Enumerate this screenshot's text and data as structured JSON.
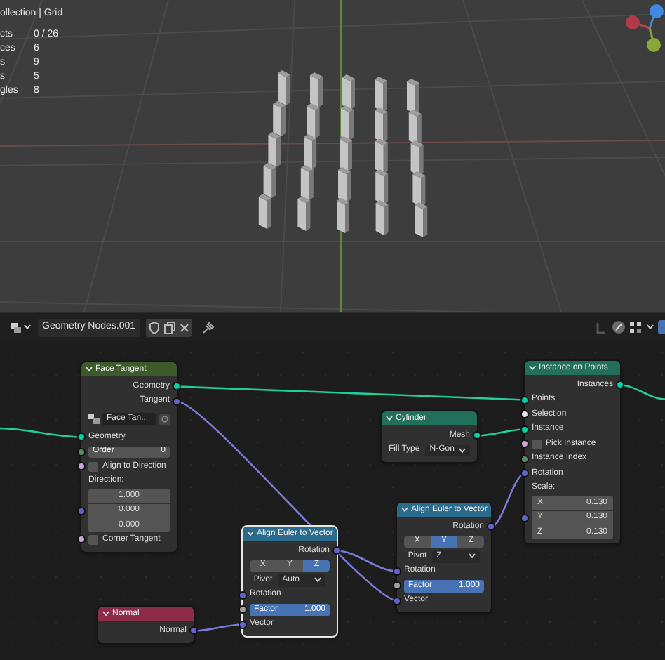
{
  "viewport": {
    "overlay_text": "ollection | Grid",
    "stats": [
      {
        "label": "cts",
        "value": "0 / 26"
      },
      {
        "label": "ces",
        "value": "6"
      },
      {
        "label": "s",
        "value": "9"
      },
      {
        "label": "s",
        "value": "5"
      },
      {
        "label": "gles",
        "value": "8"
      }
    ]
  },
  "node_editor": {
    "datablock": "Geometry Nodes.001"
  },
  "nodes": [
    {
      "title": "Face Tangent",
      "color": "#3d5a2a",
      "selected": false,
      "rows": [
        {
          "kind": "output",
          "label": "Geometry",
          "color": "#00d6a3"
        },
        {
          "kind": "output",
          "label": "Tangent",
          "color": "#6363c7"
        },
        {
          "kind": "datablock",
          "value": "Face Tan..."
        },
        {
          "kind": "input",
          "label": "Geometry",
          "color": "#00d6a3"
        },
        {
          "kind": "field",
          "label": "Order",
          "value": "0",
          "color": "#598c5c"
        },
        {
          "kind": "checkbox",
          "label": "Align to Direction",
          "checked": false,
          "color": "#cca6d6"
        },
        {
          "kind": "heading",
          "label": "Direction:"
        },
        {
          "kind": "vector",
          "color": "#6363c7",
          "values": [
            {
              "value": "1.000"
            },
            {
              "value": "0.000"
            },
            {
              "value": "0.000"
            }
          ]
        },
        {
          "kind": "checkbox",
          "label": "Corner Tangent",
          "checked": false,
          "color": "#cca6d6"
        }
      ]
    },
    {
      "title": "Instance on Points",
      "color": "#22705c",
      "selected": false,
      "rows": [
        {
          "kind": "output",
          "label": "Instances",
          "color": "#00d6a3"
        },
        {
          "kind": "input",
          "label": "Points",
          "color": "#00d6a3"
        },
        {
          "kind": "input",
          "label": "Selection",
          "color": "#e6e6e6"
        },
        {
          "kind": "input",
          "label": "Instance",
          "color": "#00d6a3"
        },
        {
          "kind": "checkbox",
          "label": "Pick Instance",
          "checked": false,
          "color": "#cca6d6"
        },
        {
          "kind": "input",
          "label": "Instance Index",
          "color": "#598c5c"
        },
        {
          "kind": "input",
          "label": "Rotation",
          "color": "#6363c7"
        },
        {
          "kind": "heading",
          "label": "Scale:"
        },
        {
          "kind": "vector",
          "color": "#6363c7",
          "values": [
            {
              "label": "X",
              "value": "0.130"
            },
            {
              "label": "Y",
              "value": "0.130"
            },
            {
              "label": "Z",
              "value": "0.130"
            }
          ]
        }
      ]
    },
    {
      "title": "Cylinder",
      "color": "#22705c",
      "selected": false,
      "rows": [
        {
          "kind": "output",
          "label": "Mesh",
          "color": "#00d6a3"
        },
        {
          "kind": "select",
          "label": "Fill Type",
          "value": "N-Gon"
        }
      ]
    },
    {
      "title": "Align Euler to Vector",
      "color": "#2a6a8c",
      "selected": false,
      "rows": [
        {
          "kind": "output",
          "label": "Rotation",
          "color": "#6363c7"
        },
        {
          "kind": "axis",
          "options": [
            {
              "label": "X",
              "selected": false
            },
            {
              "label": "Y",
              "selected": true
            },
            {
              "label": "Z",
              "selected": false
            }
          ]
        },
        {
          "kind": "select",
          "label": "Pivot",
          "value": "Z"
        },
        {
          "kind": "input",
          "label": "Rotation",
          "color": "#6363c7"
        },
        {
          "kind": "field",
          "label": "Factor",
          "value": "1.000",
          "level": 1,
          "color": "#a1a1a1"
        },
        {
          "kind": "input",
          "label": "Vector",
          "color": "#6363c7"
        }
      ]
    },
    {
      "title": "Align Euler to Vector",
      "color": "#2a6a8c",
      "selected": true,
      "rows": [
        {
          "kind": "output",
          "label": "Rotation",
          "color": "#6363c7"
        },
        {
          "kind": "axis",
          "options": [
            {
              "label": "X",
              "selected": false
            },
            {
              "label": "Y",
              "selected": false
            },
            {
              "label": "Z",
              "selected": true
            }
          ]
        },
        {
          "kind": "select",
          "label": "Pivot",
          "value": "Auto"
        },
        {
          "kind": "input",
          "label": "Rotation",
          "color": "#6363c7"
        },
        {
          "kind": "field",
          "label": "Factor",
          "value": "1.000",
          "level": 1,
          "color": "#a1a1a1"
        },
        {
          "kind": "input",
          "label": "Vector",
          "color": "#6363c7"
        }
      ]
    },
    {
      "title": "Normal",
      "color": "#8c2c48",
      "selected": false,
      "rows": [
        {
          "kind": "output",
          "label": "Normal",
          "color": "#6363c7"
        }
      ]
    }
  ]
}
